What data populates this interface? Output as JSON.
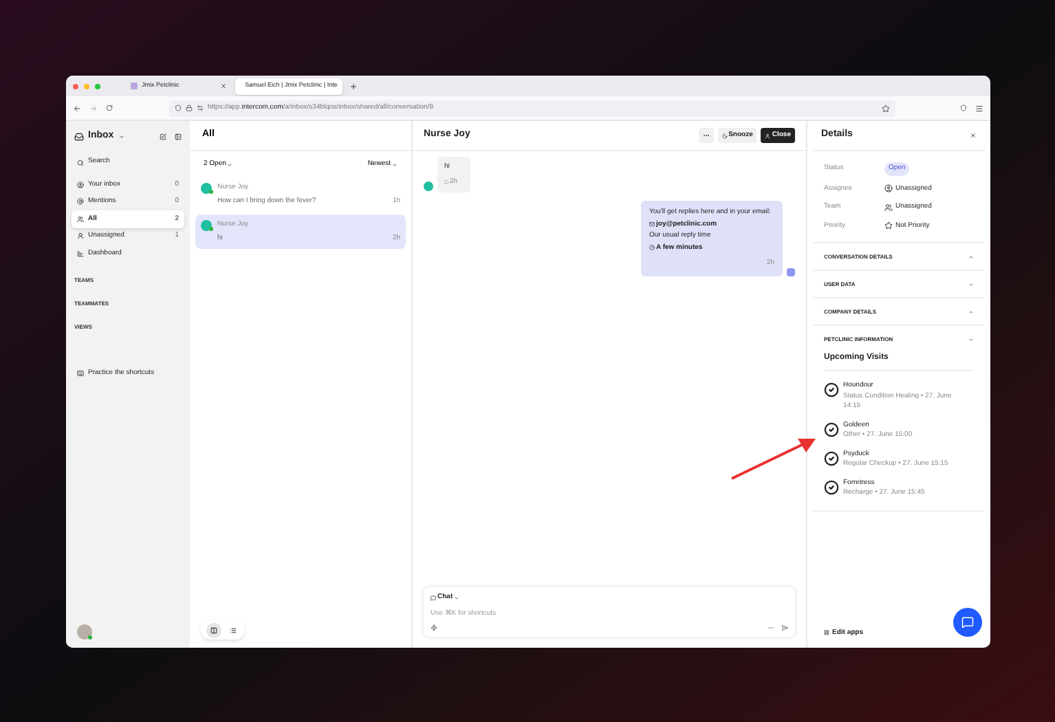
{
  "browser": {
    "tabs": [
      {
        "title": "Jmix Petclinic",
        "selected": false
      },
      {
        "title": "Samuel Eich | Jmix Petclinic | Inte",
        "selected": true
      }
    ],
    "url": {
      "prefix": "https://app.",
      "domain": "intercom.com",
      "path": "/a/inbox/s34blqos/inbox/shared/all/conversation/9"
    }
  },
  "sidebar": {
    "title": "Inbox",
    "search": "Search",
    "items": [
      {
        "label": "Your inbox",
        "count": "0",
        "selected": false
      },
      {
        "label": "Mentions",
        "count": "0",
        "selected": false
      },
      {
        "label": "All",
        "count": "2",
        "selected": true
      },
      {
        "label": "Unassigned",
        "count": "1",
        "selected": false
      },
      {
        "label": "Dashboard",
        "selected": false
      }
    ],
    "sections": [
      "TEAMS",
      "TEAMMATES",
      "VIEWS"
    ],
    "shortcuts": "Practice the shortcuts"
  },
  "list": {
    "title": "All",
    "filter": "2 Open",
    "sort": "Newest",
    "conversations": [
      {
        "name": "Nurse Joy",
        "preview": "How can I bring down the fever?",
        "time": "1h",
        "selected": false
      },
      {
        "name": "Nurse Joy",
        "preview": "hi",
        "time": "2h",
        "selected": true
      }
    ],
    "view_modes": [
      {
        "kind": "split",
        "selected": true
      },
      {
        "kind": "list",
        "selected": false
      }
    ]
  },
  "conversation": {
    "title": "Nurse Joy",
    "snooze": "Snooze",
    "close": "Close",
    "incoming": {
      "text": "hi",
      "time": "2h"
    },
    "outgoing": {
      "lines": [
        {
          "kind": "plain",
          "text": "You'll get replies here and in your email:"
        },
        {
          "kind": "email",
          "text": "joy@petclinic.com"
        },
        {
          "kind": "plain",
          "text": "Our usual reply time"
        },
        {
          "kind": "time",
          "text": "A few minutes"
        }
      ],
      "time": "2h"
    },
    "composer": {
      "channel": "Chat",
      "placeholder": "Use ⌘K for shortcuts"
    }
  },
  "details": {
    "title": "Details",
    "fields": [
      {
        "label": "Status",
        "value": "Open",
        "kind": "badge"
      },
      {
        "label": "Assignee",
        "value": "Unassigned",
        "kind": "person"
      },
      {
        "label": "Team",
        "value": "Unassigned",
        "kind": "team"
      },
      {
        "label": "Priority",
        "value": "Not Priority",
        "kind": "priority"
      }
    ],
    "sections": [
      {
        "title": "CONVERSATION DETAILS",
        "expanded": false
      },
      {
        "title": "USER DATA",
        "expanded": false
      },
      {
        "title": "COMPANY DETAILS",
        "expanded": false
      },
      {
        "title": "PETCLINIC INFORMATION",
        "expanded": true
      }
    ],
    "upcoming_title": "Upcoming Visits",
    "visits": [
      {
        "name": "Houndour",
        "detail": "Status Condition Healing • 27. June 14:15"
      },
      {
        "name": "Goldeen",
        "detail": "Other • 27. June 15:00"
      },
      {
        "name": "Psyduck",
        "detail": "Regular Checkup • 27. June 15:15"
      },
      {
        "name": "Forretress",
        "detail": "Recharge • 27. June 15:45"
      }
    ],
    "edit_apps": "Edit apps"
  }
}
